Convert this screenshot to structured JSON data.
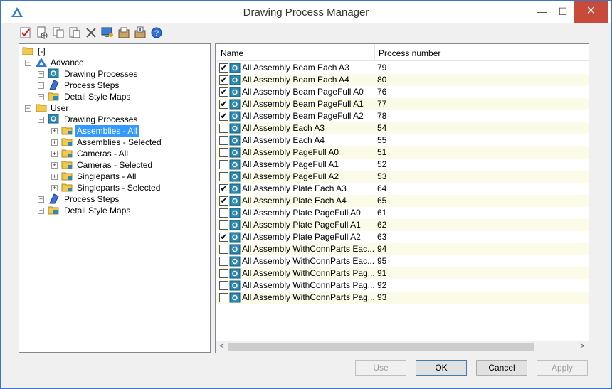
{
  "window": {
    "title": "Drawing Process Manager",
    "minimize": "—",
    "maximize": "☐",
    "close": "✕"
  },
  "toolbar": {
    "buttons": [
      "check-icon",
      "new-icon",
      "copy-icon",
      "paste-icon",
      "delete-icon",
      "monitor-icon",
      "import-icon",
      "export-icon",
      "help-icon"
    ]
  },
  "tree": {
    "root": "[-]",
    "advance": {
      "label": "Advance",
      "items": [
        "Drawing Processes",
        "Process Steps",
        "Detail Style Maps"
      ]
    },
    "user": {
      "label": "User",
      "drawing_processes": "Drawing Processes",
      "children": [
        "Assemblies - All",
        "Assemblies - Selected",
        "Cameras - All",
        "Cameras - Selected",
        "Singleparts - All",
        "Singleparts - Selected"
      ],
      "process_steps": "Process Steps",
      "detail_style_maps": "Detail Style Maps"
    }
  },
  "list": {
    "columns": [
      "Name",
      "Process number"
    ],
    "rows": [
      {
        "name": "All Assembly Beam Each A3",
        "number": "79",
        "checked": true
      },
      {
        "name": "All Assembly Beam Each A4",
        "number": "80",
        "checked": true
      },
      {
        "name": "All Assembly Beam PageFull A0",
        "number": "76",
        "checked": true
      },
      {
        "name": "All Assembly Beam PageFull A1",
        "number": "77",
        "checked": true
      },
      {
        "name": "All Assembly Beam PageFull A2",
        "number": "78",
        "checked": true
      },
      {
        "name": "All Assembly Each A3",
        "number": "54",
        "checked": false
      },
      {
        "name": "All Assembly Each A4",
        "number": "55",
        "checked": false
      },
      {
        "name": "All Assembly PageFull A0",
        "number": "51",
        "checked": false
      },
      {
        "name": "All Assembly PageFull A1",
        "number": "52",
        "checked": false
      },
      {
        "name": "All Assembly PageFull A2",
        "number": "53",
        "checked": false
      },
      {
        "name": "All Assembly Plate Each A3",
        "number": "64",
        "checked": true
      },
      {
        "name": "All Assembly Plate Each A4",
        "number": "65",
        "checked": true
      },
      {
        "name": "All Assembly Plate PageFull A0",
        "number": "61",
        "checked": false
      },
      {
        "name": "All Assembly Plate PageFull A1",
        "number": "62",
        "checked": false
      },
      {
        "name": "All Assembly Plate PageFull A2",
        "number": "63",
        "checked": true
      },
      {
        "name": "All Assembly WithConnParts Eac...",
        "number": "94",
        "checked": false
      },
      {
        "name": "All Assembly WithConnParts Eac...",
        "number": "95",
        "checked": false
      },
      {
        "name": "All Assembly WithConnParts Pag...",
        "number": "91",
        "checked": false
      },
      {
        "name": "All Assembly WithConnParts Pag...",
        "number": "92",
        "checked": false
      },
      {
        "name": "All Assembly WithConnParts Pag...",
        "number": "93",
        "checked": false
      }
    ],
    "scroll_left": "<",
    "scroll_right": ">"
  },
  "buttons": {
    "use": "Use",
    "ok": "OK",
    "cancel": "Cancel",
    "apply": "Apply"
  },
  "colors": {
    "selection": "#3399ff",
    "close_button": "#c74a3b",
    "alt_row": "#fbfbe8"
  }
}
